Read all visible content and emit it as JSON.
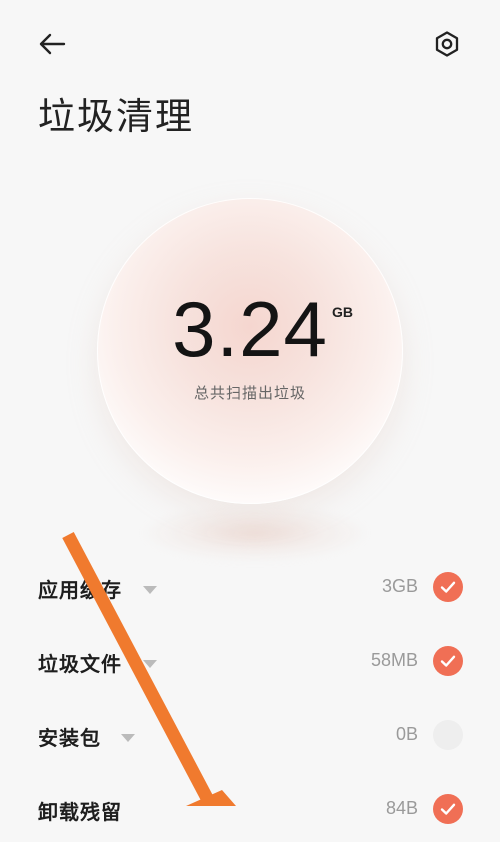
{
  "header": {
    "title": "垃圾清理",
    "back_icon": "arrow-left-icon",
    "settings_icon": "hexagon-settings-icon"
  },
  "summary": {
    "value": "3.24",
    "unit": "GB",
    "caption": "总共扫描出垃圾"
  },
  "items": [
    {
      "name": "应用缓存",
      "size": "3GB",
      "checked": true
    },
    {
      "name": "垃圾文件",
      "size": "58MB",
      "checked": true
    },
    {
      "name": "安装包",
      "size": "0B",
      "checked": false
    },
    {
      "name": "卸载残留",
      "size": "84B",
      "checked": true
    }
  ],
  "colors": {
    "accent": "#f06f55",
    "annotation_arrow": "#f07a2e",
    "background": "#f7f7f7"
  }
}
